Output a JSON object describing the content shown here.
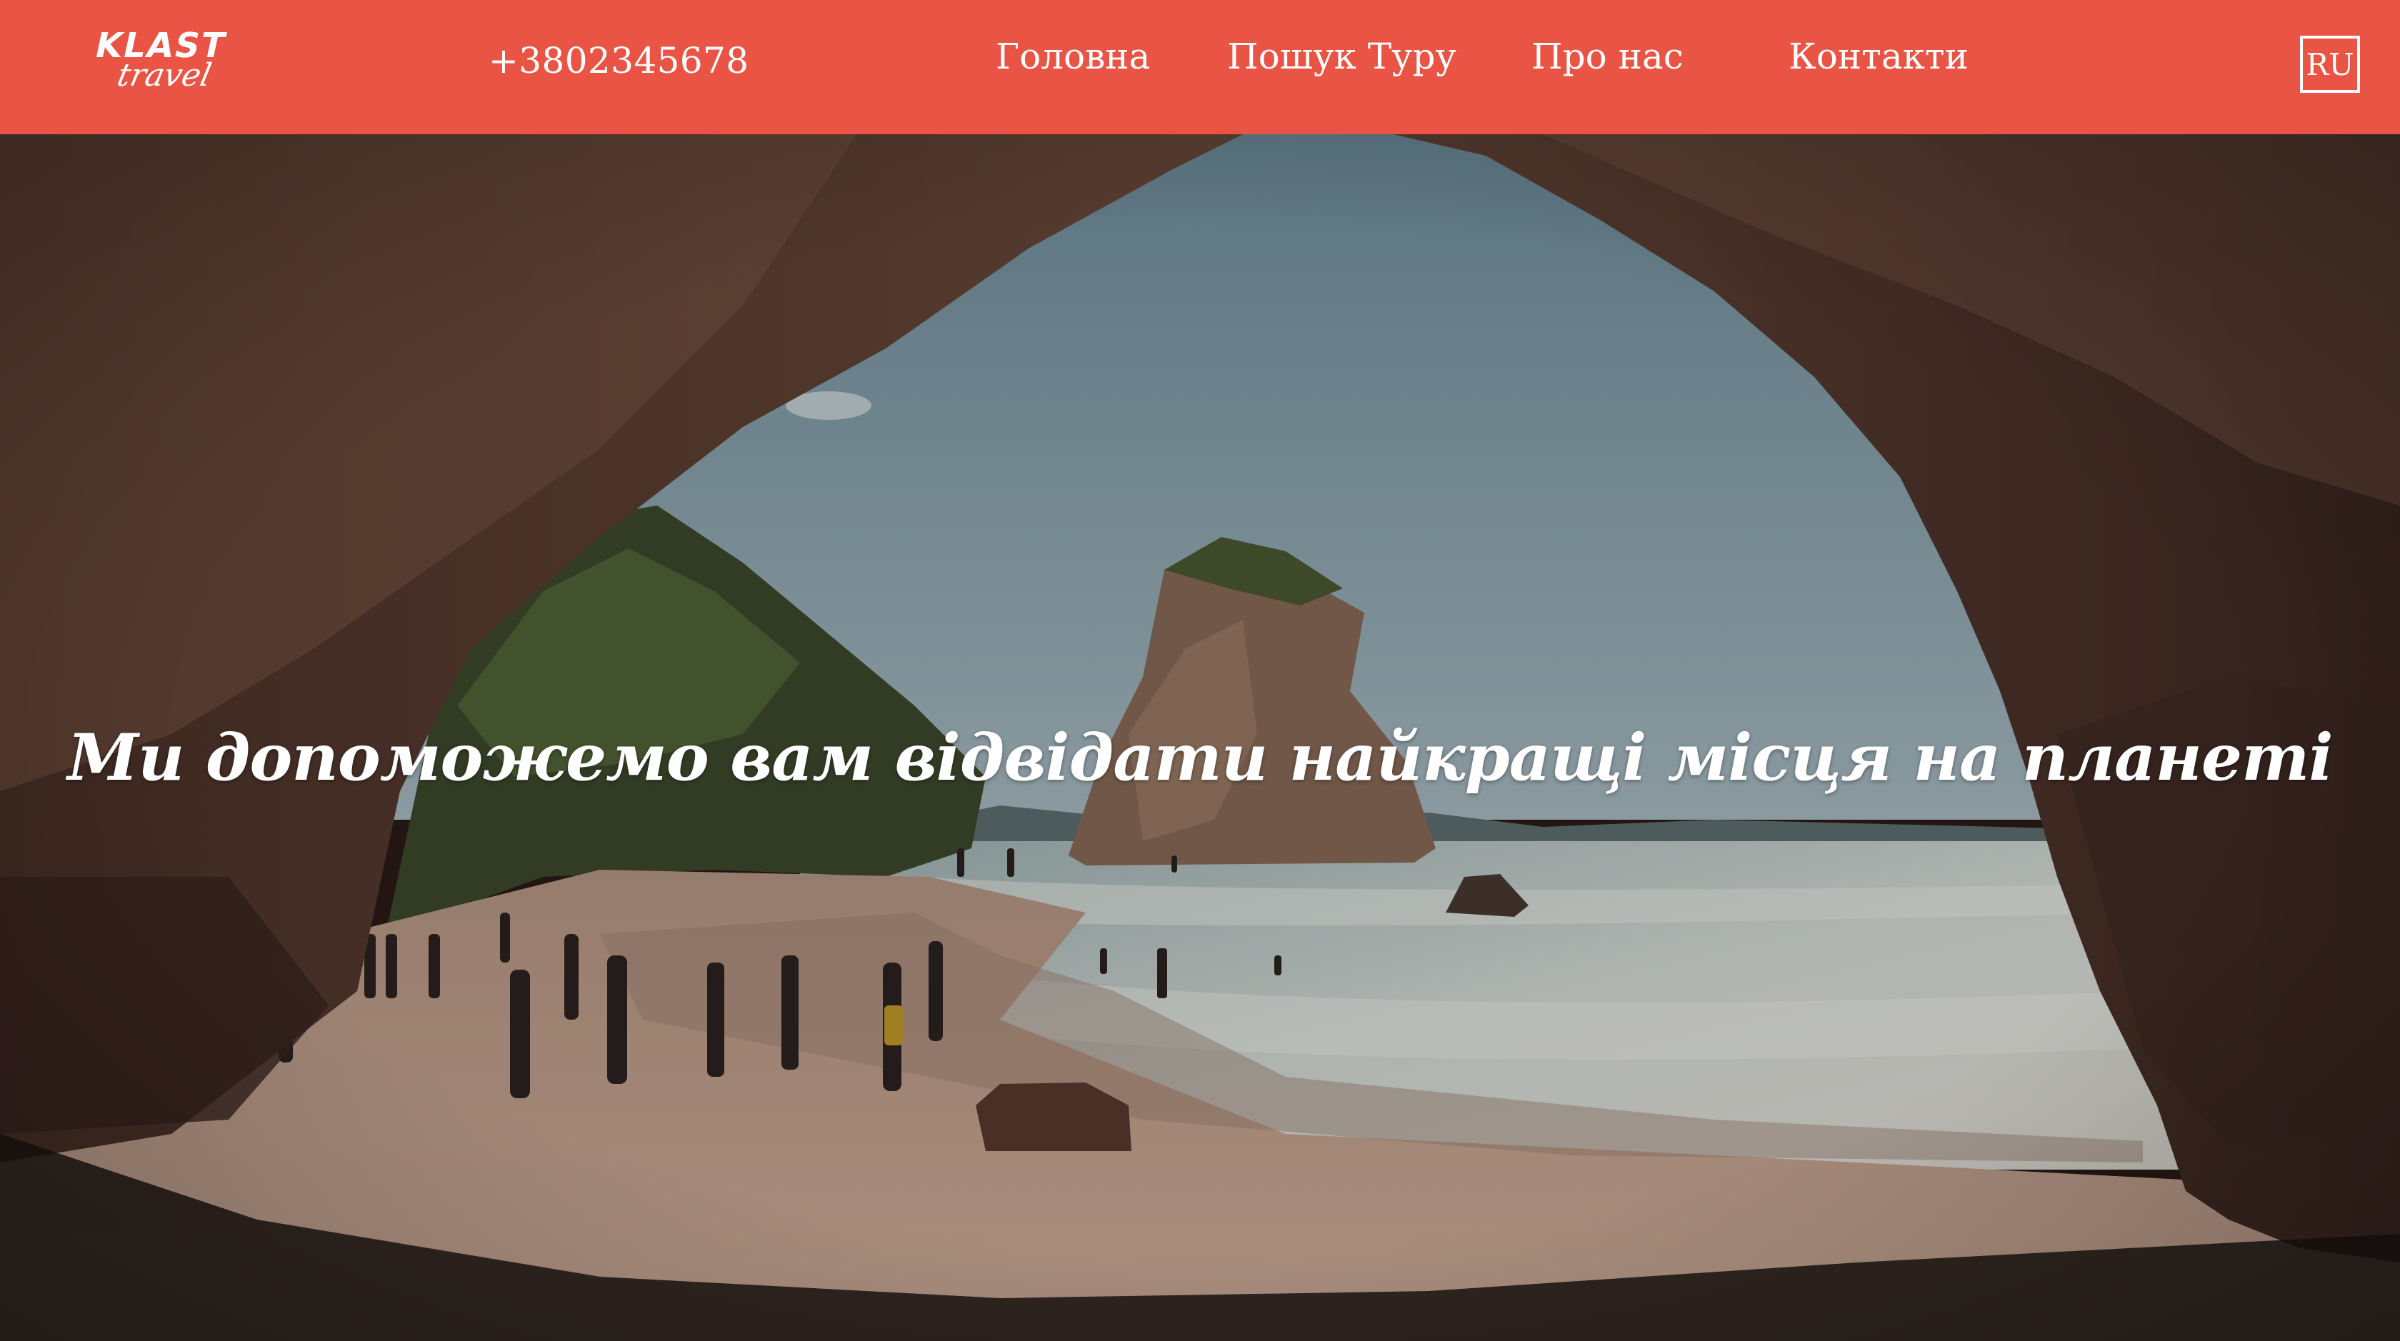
{
  "header": {
    "logo_top": "KLAST",
    "logo_bottom": "travel",
    "phone": "+3802345678",
    "nav": [
      {
        "label": "Головна"
      },
      {
        "label": "Пошук Туру"
      },
      {
        "label": "Про нас"
      },
      {
        "label": "Контакти"
      }
    ],
    "language": "RU"
  },
  "hero": {
    "title": "Ми допоможемо вам відвідати найкращі місця на планеті"
  },
  "colors": {
    "header_bg": "#e95445",
    "text": "#ffffff",
    "rock": "#5a3a2e",
    "sky": "#8fa9b5",
    "sea": "#c9d3d2",
    "sand": "#c9a48f"
  },
  "icons": {
    "hero": "sea-cave-beach-photo"
  }
}
